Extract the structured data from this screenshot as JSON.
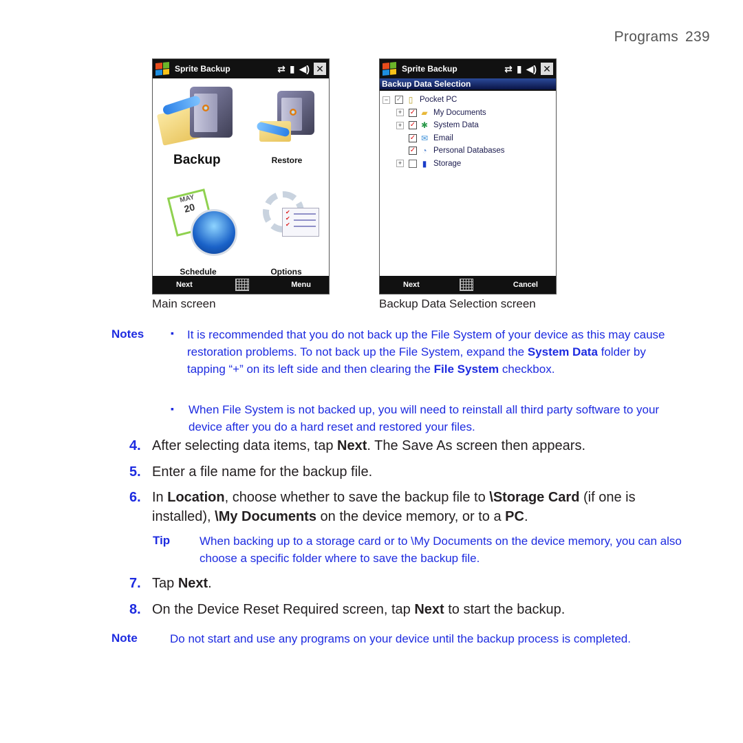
{
  "header": {
    "section": "Programs",
    "page_number": "239"
  },
  "figures": {
    "main_screen": {
      "title": "Sprite Backup",
      "status_icons": [
        "connectivity-icon",
        "signal-icon",
        "volume-icon",
        "close-icon"
      ],
      "close_glyph": "✕",
      "tiles": [
        {
          "label": "Backup",
          "icon": "backup-safe-icon"
        },
        {
          "label": "Restore",
          "icon": "restore-safe-icon"
        },
        {
          "label": "Schedule",
          "icon": "schedule-calendar-clock-icon",
          "calendar_month": "MAY",
          "calendar_day": "20"
        },
        {
          "label": "Options",
          "icon": "options-gear-checklist-icon"
        }
      ],
      "softkeys": {
        "left": "Next",
        "right": "Menu"
      },
      "caption": "Main screen"
    },
    "selection_screen": {
      "title": "Sprite Backup",
      "close_glyph": "✕",
      "section_title": "Backup Data Selection",
      "tree": [
        {
          "label": "Pocket PC",
          "level": 1,
          "expander": "−",
          "checked": "partial",
          "icon": "pocket-pc-icon"
        },
        {
          "label": "My Documents",
          "level": 2,
          "expander": "+",
          "checked": true,
          "icon": "folder-icon"
        },
        {
          "label": "System Data",
          "level": 2,
          "expander": "+",
          "checked": true,
          "icon": "system-data-icon"
        },
        {
          "label": "Email",
          "level": 2,
          "expander": "",
          "checked": true,
          "icon": "email-icon"
        },
        {
          "label": "Personal Databases",
          "level": 2,
          "expander": "",
          "checked": true,
          "icon": "database-icon"
        },
        {
          "label": "Storage",
          "level": 2,
          "expander": "+",
          "checked": false,
          "icon": "storage-card-icon"
        }
      ],
      "softkeys": {
        "left": "Next",
        "right": "Cancel"
      },
      "caption": "Backup Data Selection screen"
    }
  },
  "notes": {
    "label": "Notes",
    "items": [
      {
        "parts": [
          {
            "t": "It is recommended that you do not back up the File System of your device as this may cause restoration problems. To not back up the File System, expand the "
          },
          {
            "t": "System Data",
            "b": true
          },
          {
            "t": " folder by tapping “+” on its left side and then clearing the "
          },
          {
            "t": "File System",
            "b": true
          },
          {
            "t": " checkbox."
          }
        ]
      },
      {
        "parts": [
          {
            "t": "When File System is not backed up, you will need to reinstall all third party software to your device after you do a hard reset and restored your files."
          }
        ]
      }
    ]
  },
  "steps": [
    {
      "num": "4.",
      "parts": [
        {
          "t": "After selecting data items, tap "
        },
        {
          "t": "Next",
          "b": true
        },
        {
          "t": ". The Save As screen then appears."
        }
      ]
    },
    {
      "num": "5.",
      "parts": [
        {
          "t": "Enter a file name for the backup file."
        }
      ]
    },
    {
      "num": "6.",
      "parts": [
        {
          "t": "In "
        },
        {
          "t": "Location",
          "b": true
        },
        {
          "t": ", choose whether to save the backup file to "
        },
        {
          "t": "\\Storage Card",
          "b": true
        },
        {
          "t": " (if one is installed), "
        },
        {
          "t": "\\My Documents",
          "b": true
        },
        {
          "t": " on the device memory, or to a "
        },
        {
          "t": "PC",
          "b": true
        },
        {
          "t": "."
        }
      ]
    },
    {
      "num": "7.",
      "parts": [
        {
          "t": "Tap "
        },
        {
          "t": "Next",
          "b": true
        },
        {
          "t": "."
        }
      ]
    },
    {
      "num": "8.",
      "parts": [
        {
          "t": "On the Device Reset Required screen, tap "
        },
        {
          "t": "Next",
          "b": true
        },
        {
          "t": " to start the backup."
        }
      ]
    }
  ],
  "tip": {
    "label": "Tip",
    "text": "When backing up to a storage card or to \\My Documents on the device memory, you can also choose a specific folder where to save the backup file."
  },
  "final_note": {
    "label": "Note",
    "text": "Do not start and use any programs on your device until the backup process is completed."
  },
  "colors": {
    "accent_blue": "#1d2be0",
    "body_text": "#231f20",
    "titlebar": "#111111"
  }
}
